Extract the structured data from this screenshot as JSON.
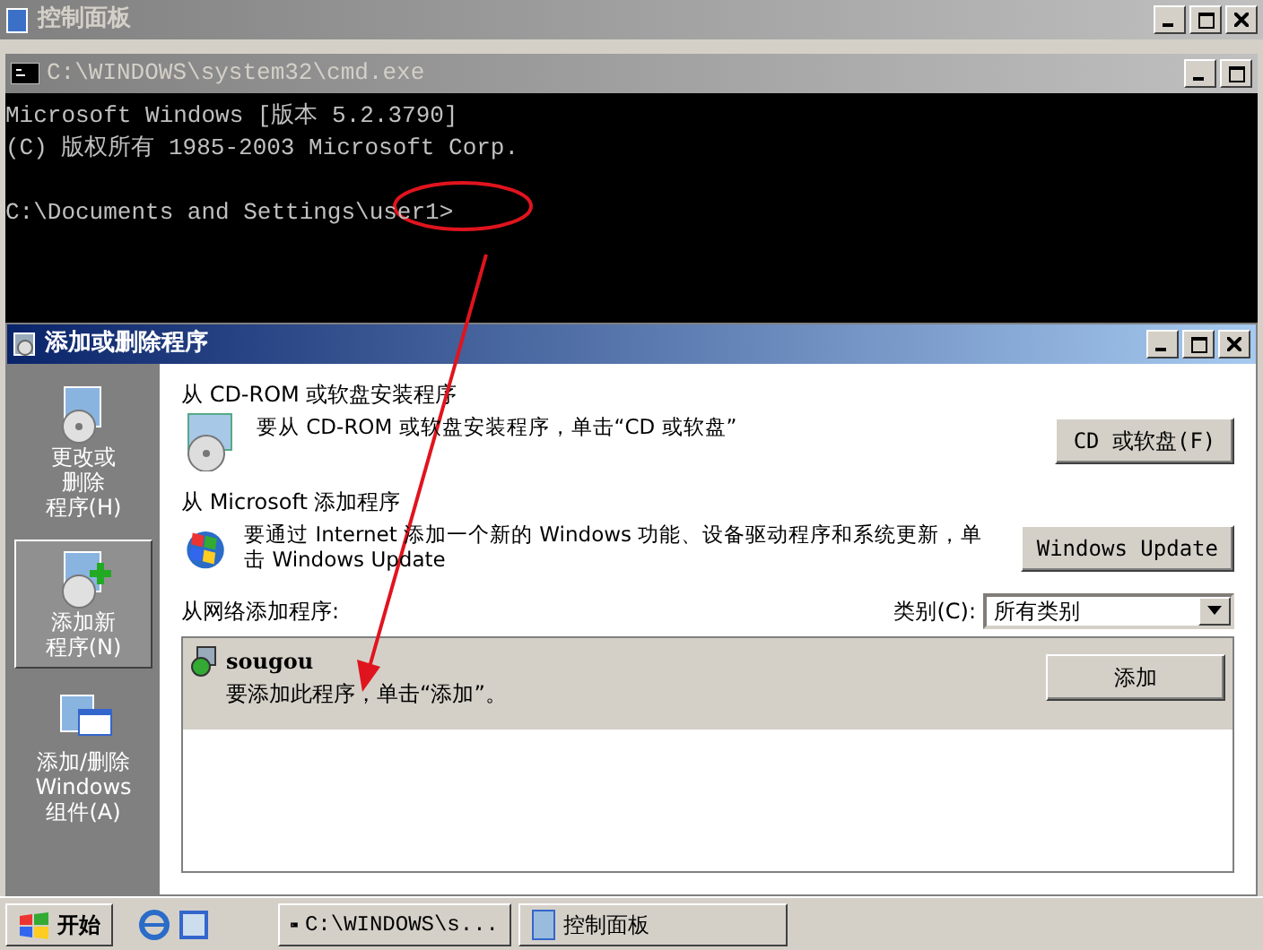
{
  "control_panel": {
    "title": "控制面板"
  },
  "cmd": {
    "title": "C:\\WINDOWS\\system32\\cmd.exe",
    "lines": [
      "Microsoft Windows [版本 5.2.3790]",
      "(C) 版权所有 1985-2003 Microsoft Corp."
    ],
    "prompt": "C:\\Documents and Settings\\user1>"
  },
  "add_remove": {
    "title": "添加或删除程序",
    "sidebar": [
      {
        "lines": [
          "更改或",
          "删除",
          "程序(H)"
        ],
        "kind": "change",
        "selected": false
      },
      {
        "lines": [
          "添加新",
          "程序(N)"
        ],
        "kind": "add",
        "selected": true
      },
      {
        "lines": [
          "添加/删除",
          "Windows",
          "组件(A)"
        ],
        "kind": "components",
        "selected": false
      }
    ],
    "sections": [
      {
        "heading": "从 CD-ROM 或软盘安装程序",
        "text": "要从 CD-ROM 或软盘安装程序，单击“CD 或软盘”",
        "button": "CD 或软盘(F)",
        "kind": "cd"
      },
      {
        "heading": "从 Microsoft 添加程序",
        "text": "要通过 Internet 添加一个新的 Windows 功能、设备驱动程序和系统更新，单击 Windows Update",
        "button": "Windows Update",
        "kind": "update"
      }
    ],
    "network": {
      "heading": "从网络添加程序:",
      "category_label": "类别(C):",
      "category_value": "所有类别",
      "programs": [
        {
          "name": "sougou",
          "text": "要添加此程序，单击“添加”。",
          "button": "添加",
          "selected": true
        }
      ]
    }
  },
  "taskbar": {
    "start": "开始",
    "tasks": [
      {
        "label": "C:\\WINDOWS\\s...",
        "kind": "console",
        "selected": false
      },
      {
        "label": "控制面板",
        "kind": "panel",
        "selected": false
      }
    ]
  }
}
